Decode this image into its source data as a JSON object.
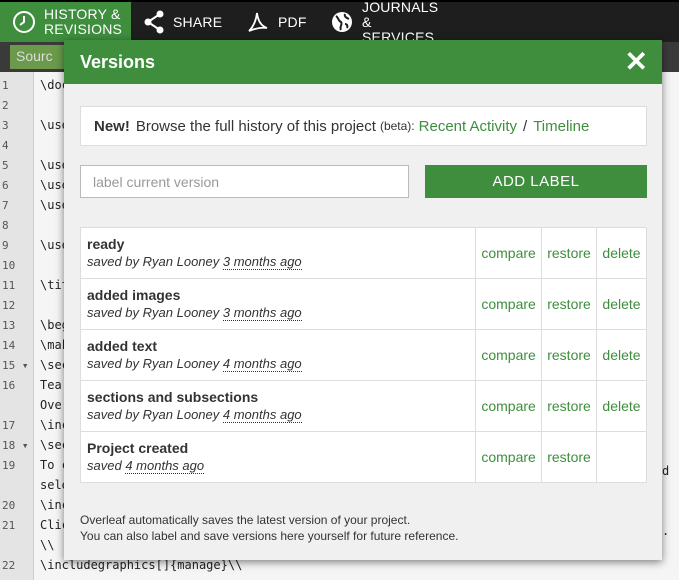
{
  "toolbar": {
    "history_line1": "HISTORY &",
    "history_line2": "REVISIONS",
    "share": "SHARE",
    "pdf": "PDF",
    "journals_line1": "JOURNALS",
    "journals_line2": "& SERVICES"
  },
  "editor": {
    "source_tab": "Sourc",
    "lines": [
      {
        "n": "1",
        "text": "\\doc"
      },
      {
        "n": "2",
        "text": ""
      },
      {
        "n": "3",
        "text": "\\use"
      },
      {
        "n": "4",
        "text": ""
      },
      {
        "n": "5",
        "text": "\\use"
      },
      {
        "n": "6",
        "text": "\\use"
      },
      {
        "n": "7",
        "text": "\\use"
      },
      {
        "n": "8",
        "text": ""
      },
      {
        "n": "9",
        "text": "\\use"
      },
      {
        "n": "10",
        "text": ""
      },
      {
        "n": "11",
        "text": "\\tit"
      },
      {
        "n": "12",
        "text": ""
      },
      {
        "n": "13",
        "text": "\\beg"
      },
      {
        "n": "14",
        "text": "\\mak"
      },
      {
        "n": "15 ▾",
        "text": "\\sec"
      },
      {
        "n": "16",
        "text": "Tea"
      },
      {
        "n": "",
        "text": "Ove"
      },
      {
        "n": "17",
        "text": "\\inc"
      },
      {
        "n": "18 ▾",
        "text": "\\sec"
      },
      {
        "n": "19",
        "text": "To c"
      },
      {
        "n": "",
        "text": "sele"
      },
      {
        "n": "20",
        "text": "\\inc"
      },
      {
        "n": "21",
        "text": "Clic"
      },
      {
        "n": "",
        "text": "\\\\"
      },
      {
        "n": "22",
        "text": "\\includegraphics[]{manage}\\\\"
      }
    ],
    "right_chars": [
      "d",
      "."
    ]
  },
  "modal": {
    "title": "Versions",
    "close": "✕",
    "notice": {
      "bold": "New!",
      "text": "Browse the full history of this project",
      "beta": "(beta):",
      "link1": "Recent Activity",
      "separator": "/",
      "link2": "Timeline"
    },
    "label_placeholder": "label current version",
    "add_label": "ADD LABEL",
    "actions": {
      "compare": "compare",
      "restore": "restore",
      "delete": "delete"
    },
    "versions": [
      {
        "name": "ready",
        "saved_prefix": "saved by Ryan Looney",
        "ago": "3 months ago",
        "deletable": true
      },
      {
        "name": "added images",
        "saved_prefix": "saved by Ryan Looney",
        "ago": "3 months ago",
        "deletable": true
      },
      {
        "name": "added text",
        "saved_prefix": "saved by Ryan Looney",
        "ago": "4 months ago",
        "deletable": true
      },
      {
        "name": "sections and subsections",
        "saved_prefix": "saved by Ryan Looney",
        "ago": "4 months ago",
        "deletable": true
      },
      {
        "name": "Project created",
        "saved_prefix": "saved",
        "ago": "4 months ago",
        "deletable": false
      }
    ],
    "footer_line1": "Overleaf automatically saves the latest version of your project.",
    "footer_line2": "You can also label and save versions here yourself for future reference."
  }
}
